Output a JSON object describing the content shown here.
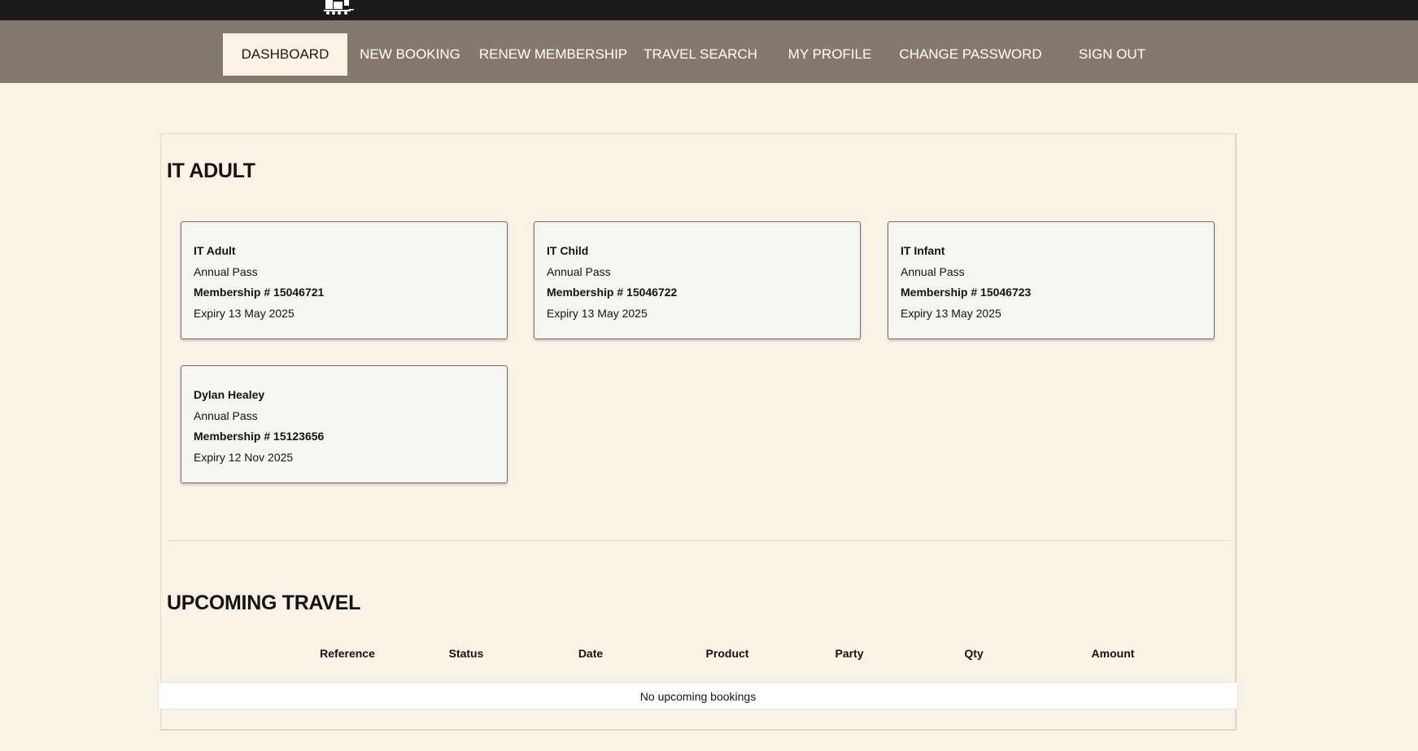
{
  "nav": {
    "items": [
      {
        "label": "DASHBOARD",
        "active": true
      },
      {
        "label": "NEW BOOKING",
        "active": false
      },
      {
        "label": "RENEW MEMBERSHIP",
        "active": false
      },
      {
        "label": "TRAVEL SEARCH",
        "active": false
      },
      {
        "label": "MY PROFILE",
        "active": false
      },
      {
        "label": "CHANGE PASSWORD",
        "active": false
      },
      {
        "label": "SIGN OUT",
        "active": false
      }
    ]
  },
  "account": {
    "title": "IT ADULT"
  },
  "members": [
    {
      "name": "IT Adult",
      "pass": "Annual Pass",
      "membership": "Membership # 15046721",
      "expiry": "Expiry 13 May 2025"
    },
    {
      "name": "IT Child",
      "pass": "Annual Pass",
      "membership": "Membership # 15046722",
      "expiry": "Expiry 13 May 2025"
    },
    {
      "name": "IT Infant",
      "pass": "Annual Pass",
      "membership": "Membership # 15046723",
      "expiry": "Expiry 13 May 2025"
    },
    {
      "name": "Dylan Healey",
      "pass": "Annual Pass",
      "membership": "Membership # 15123656",
      "expiry": "Expiry 12 Nov 2025"
    }
  ],
  "upcoming": {
    "title": "UPCOMING TRAVEL",
    "columns": [
      "Reference",
      "Status",
      "Date",
      "Product",
      "Party",
      "Qty",
      "Amount"
    ],
    "empty_message": "No upcoming bookings"
  },
  "colors": {
    "topbar": "#1a1a1a",
    "navbar": "#85796f",
    "page_background": "#f9f2e5",
    "card_background": "#f6f5f2"
  },
  "icons": {
    "logo": "train-logo-icon"
  }
}
